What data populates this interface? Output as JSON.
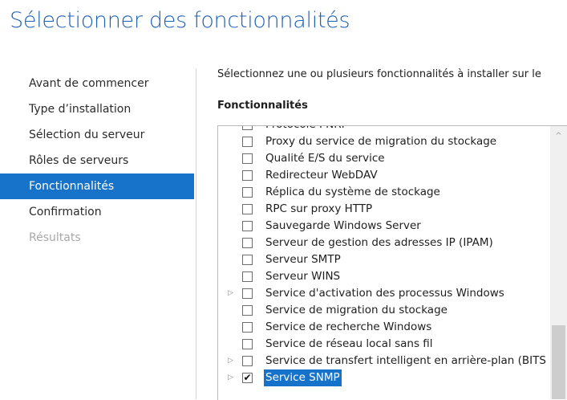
{
  "title": "Sélectionner des fonctionnalités",
  "nav": [
    {
      "label": "Avant de commencer",
      "state": "normal"
    },
    {
      "label": "Type d’installation",
      "state": "normal"
    },
    {
      "label": "Sélection du serveur",
      "state": "normal"
    },
    {
      "label": "Rôles de serveurs",
      "state": "normal"
    },
    {
      "label": "Fonctionnalités",
      "state": "active"
    },
    {
      "label": "Confirmation",
      "state": "normal"
    },
    {
      "label": "Résultats",
      "state": "disabled"
    }
  ],
  "intro": "Sélectionnez une ou plusieurs fonctionnalités à installer sur le",
  "section_title": "Fonctionnalités",
  "features": [
    {
      "label": "Protocole PNRP",
      "checked": false,
      "expandable": false,
      "selected": false
    },
    {
      "label": "Proxy du service de migration du stockage",
      "checked": false,
      "expandable": false,
      "selected": false
    },
    {
      "label": "Qualité E/S du service",
      "checked": false,
      "expandable": false,
      "selected": false
    },
    {
      "label": "Redirecteur WebDAV",
      "checked": false,
      "expandable": false,
      "selected": false
    },
    {
      "label": "Réplica du système de stockage",
      "checked": false,
      "expandable": false,
      "selected": false
    },
    {
      "label": "RPC sur proxy HTTP",
      "checked": false,
      "expandable": false,
      "selected": false
    },
    {
      "label": "Sauvegarde Windows Server",
      "checked": false,
      "expandable": false,
      "selected": false
    },
    {
      "label": "Serveur de gestion des adresses IP (IPAM)",
      "checked": false,
      "expandable": false,
      "selected": false
    },
    {
      "label": "Serveur SMTP",
      "checked": false,
      "expandable": false,
      "selected": false
    },
    {
      "label": "Serveur WINS",
      "checked": false,
      "expandable": false,
      "selected": false
    },
    {
      "label": "Service d'activation des processus Windows",
      "checked": false,
      "expandable": true,
      "selected": false
    },
    {
      "label": "Service de migration du stockage",
      "checked": false,
      "expandable": false,
      "selected": false
    },
    {
      "label": "Service de recherche Windows",
      "checked": false,
      "expandable": false,
      "selected": false
    },
    {
      "label": "Service de réseau local sans fil",
      "checked": false,
      "expandable": false,
      "selected": false
    },
    {
      "label": "Service de transfert intelligent en arrière-plan (BITS",
      "checked": false,
      "expandable": true,
      "selected": false
    },
    {
      "label": "Service SNMP",
      "checked": true,
      "expandable": true,
      "selected": true
    }
  ],
  "icons": {
    "expander": "triangle-right-icon",
    "check": "checkmark-icon",
    "scroll_up": "chevron-up-icon"
  },
  "colors": {
    "accent": "#1773c9",
    "title": "#1f62b5",
    "disabled": "#a8a8a8"
  }
}
